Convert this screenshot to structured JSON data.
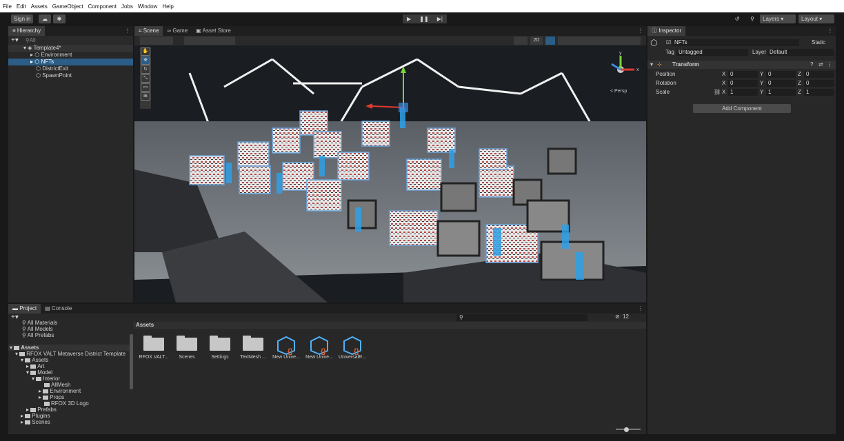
{
  "menu": [
    "File",
    "Edit",
    "Assets",
    "GameObject",
    "Component",
    "Jobs",
    "Window",
    "Help"
  ],
  "toolbar": {
    "signin_label": "Sign in",
    "layers_label": "Layers",
    "layout_label": "Layout"
  },
  "hierarchy": {
    "tab_label": "Hierarchy",
    "search_placeholder": "All",
    "rows": [
      {
        "label": "Template4*",
        "indent": 0
      },
      {
        "label": "Environment",
        "indent": 1
      },
      {
        "label": "NFTs",
        "indent": 1
      },
      {
        "label": "DistrictExit",
        "indent": 1
      },
      {
        "label": "SpawnPoint",
        "indent": 1
      }
    ]
  },
  "scene": {
    "tabs": [
      "Scene",
      "Game",
      "Asset Store"
    ],
    "mode_2d": "2D",
    "persp_label": "< Persp",
    "gizmo_y": "y",
    "gizmo_x": "x"
  },
  "inspector": {
    "tab_label": "Inspector",
    "object_name": "NFTs",
    "static_label": "Static",
    "tag_label": "Tag",
    "tag_value": "Untagged",
    "layer_label": "Layer",
    "layer_value": "Default",
    "component_title": "Transform",
    "position_label": "Position",
    "rotation_label": "Rotation",
    "scale_label": "Scale",
    "position": {
      "x": "0",
      "y": "0",
      "z": "0"
    },
    "rotation": {
      "x": "0",
      "y": "0",
      "z": "0"
    },
    "scale": {
      "x": "1",
      "y": "1",
      "z": "1"
    },
    "axis_x": "X",
    "axis_y": "Y",
    "axis_z": "Z",
    "add_component_label": "Add Component"
  },
  "project": {
    "tabs": [
      "Project",
      "Console"
    ],
    "favorites": [
      "All Materials",
      "All Models",
      "All Prefabs"
    ],
    "tree": [
      {
        "label": "Assets",
        "indent": 0
      },
      {
        "label": "RFOX VALT Metaverse District Template",
        "indent": 1
      },
      {
        "label": "Assets",
        "indent": 2
      },
      {
        "label": "Art",
        "indent": 3
      },
      {
        "label": "Model",
        "indent": 3
      },
      {
        "label": "Interior",
        "indent": 4
      },
      {
        "label": "AllMesh",
        "indent": 5
      },
      {
        "label": "Environment",
        "indent": 5
      },
      {
        "label": "Props",
        "indent": 5
      },
      {
        "label": "RFOX 3D Logo",
        "indent": 5
      },
      {
        "label": "Prefabs",
        "indent": 3
      },
      {
        "label": "Plugins",
        "indent": 2
      },
      {
        "label": "Scenes",
        "indent": 2
      }
    ],
    "breadcrumb": "Assets",
    "hidden_count": "12",
    "assets": [
      {
        "label": "RFOX VALT...",
        "kind": "folder"
      },
      {
        "label": "Scenes",
        "kind": "folder"
      },
      {
        "label": "Settings",
        "kind": "folder"
      },
      {
        "label": "TextMesh ...",
        "kind": "folder"
      },
      {
        "label": "New Unive...",
        "kind": "asset"
      },
      {
        "label": "New Unive...",
        "kind": "asset"
      },
      {
        "label": "UniversalR...",
        "kind": "asset"
      }
    ]
  }
}
